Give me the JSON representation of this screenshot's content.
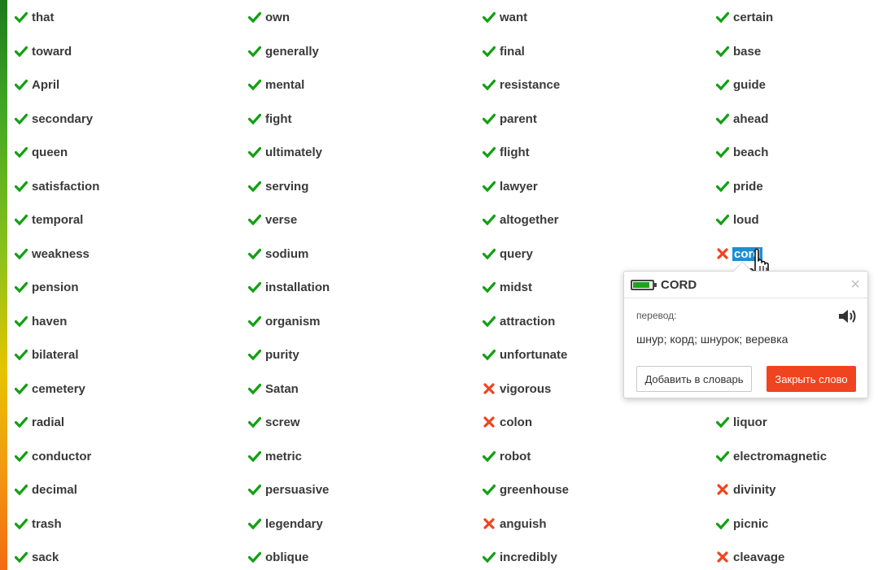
{
  "colors": {
    "correct": "#12a012",
    "wrong": "#f0431f",
    "selected_bg": "#1a8fd6",
    "close_button": "#f0431f"
  },
  "columns": [
    {
      "words": [
        {
          "text": "that",
          "status": "correct"
        },
        {
          "text": "toward",
          "status": "correct"
        },
        {
          "text": "April",
          "status": "correct"
        },
        {
          "text": "secondary",
          "status": "correct"
        },
        {
          "text": "queen",
          "status": "correct"
        },
        {
          "text": "satisfaction",
          "status": "correct"
        },
        {
          "text": "temporal",
          "status": "correct"
        },
        {
          "text": "weakness",
          "status": "correct"
        },
        {
          "text": "pension",
          "status": "correct"
        },
        {
          "text": "haven",
          "status": "correct"
        },
        {
          "text": "bilateral",
          "status": "correct"
        },
        {
          "text": "cemetery",
          "status": "correct"
        },
        {
          "text": "radial",
          "status": "correct"
        },
        {
          "text": "conductor",
          "status": "correct"
        },
        {
          "text": "decimal",
          "status": "correct"
        },
        {
          "text": "trash",
          "status": "correct"
        },
        {
          "text": "sack",
          "status": "correct"
        }
      ]
    },
    {
      "words": [
        {
          "text": "own",
          "status": "correct"
        },
        {
          "text": "generally",
          "status": "correct"
        },
        {
          "text": "mental",
          "status": "correct"
        },
        {
          "text": "fight",
          "status": "correct"
        },
        {
          "text": "ultimately",
          "status": "correct"
        },
        {
          "text": "serving",
          "status": "correct"
        },
        {
          "text": "verse",
          "status": "correct"
        },
        {
          "text": "sodium",
          "status": "correct"
        },
        {
          "text": "installation",
          "status": "correct"
        },
        {
          "text": "organism",
          "status": "correct"
        },
        {
          "text": "purity",
          "status": "correct"
        },
        {
          "text": "Satan",
          "status": "correct"
        },
        {
          "text": "screw",
          "status": "correct"
        },
        {
          "text": "metric",
          "status": "correct"
        },
        {
          "text": "persuasive",
          "status": "correct"
        },
        {
          "text": "legendary",
          "status": "correct"
        },
        {
          "text": "oblique",
          "status": "correct"
        }
      ]
    },
    {
      "words": [
        {
          "text": "want",
          "status": "correct"
        },
        {
          "text": "final",
          "status": "correct"
        },
        {
          "text": "resistance",
          "status": "correct"
        },
        {
          "text": "parent",
          "status": "correct"
        },
        {
          "text": "flight",
          "status": "correct"
        },
        {
          "text": "lawyer",
          "status": "correct"
        },
        {
          "text": "altogether",
          "status": "correct"
        },
        {
          "text": "query",
          "status": "correct"
        },
        {
          "text": "midst",
          "status": "correct"
        },
        {
          "text": "attraction",
          "status": "correct"
        },
        {
          "text": "unfortunate",
          "status": "correct"
        },
        {
          "text": "vigorous",
          "status": "wrong"
        },
        {
          "text": "colon",
          "status": "wrong"
        },
        {
          "text": "robot",
          "status": "correct"
        },
        {
          "text": "greenhouse",
          "status": "correct"
        },
        {
          "text": "anguish",
          "status": "wrong"
        },
        {
          "text": "incredibly",
          "status": "correct"
        }
      ]
    },
    {
      "words": [
        {
          "text": "certain",
          "status": "correct"
        },
        {
          "text": "base",
          "status": "correct"
        },
        {
          "text": "guide",
          "status": "correct"
        },
        {
          "text": "ahead",
          "status": "correct"
        },
        {
          "text": "beach",
          "status": "correct"
        },
        {
          "text": "pride",
          "status": "correct"
        },
        {
          "text": "loud",
          "status": "correct"
        },
        {
          "text": "cord",
          "status": "wrong",
          "selected": true
        },
        {
          "text": "",
          "status": "hidden"
        },
        {
          "text": "",
          "status": "hidden"
        },
        {
          "text": "",
          "status": "hidden"
        },
        {
          "text": "",
          "status": "hidden"
        },
        {
          "text": "liquor",
          "status": "correct"
        },
        {
          "text": "electromagnetic",
          "status": "correct"
        },
        {
          "text": "divinity",
          "status": "wrong"
        },
        {
          "text": "picnic",
          "status": "correct"
        },
        {
          "text": "cleavage",
          "status": "wrong"
        }
      ]
    }
  ],
  "popup": {
    "word": "CORD",
    "translation_label": "перевод:",
    "translation": "шнур; корд; шнурок; веревка",
    "add_button": "Добавить в словарь",
    "close_word_button": "Закрыть слово",
    "close_symbol": "×",
    "speaker_icon": "speaker-icon",
    "battery_icon": "battery-icon"
  }
}
